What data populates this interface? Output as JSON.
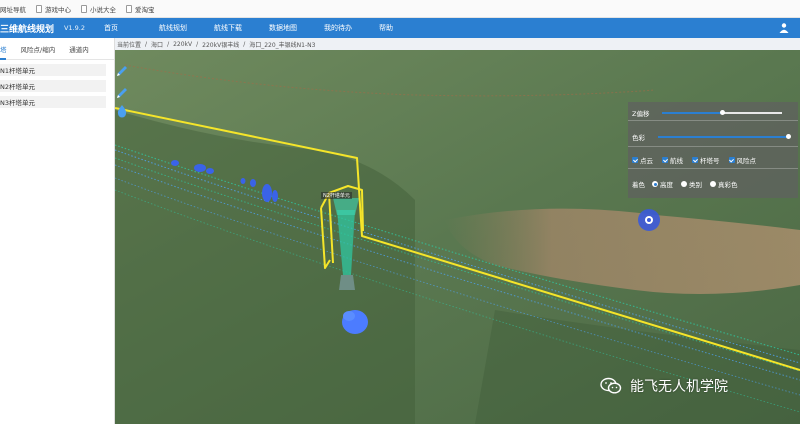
{
  "bookmarks": [
    {
      "label": "网址导航"
    },
    {
      "label": "游戏中心"
    },
    {
      "label": "小说大全"
    },
    {
      "label": "爱淘宝"
    }
  ],
  "topnav": {
    "title": "三维航线规划",
    "version": "V1.9.2",
    "items": [
      "首页",
      "航线规划",
      "航线下载",
      "数据地图",
      "我的待办",
      "帮助"
    ]
  },
  "sidebar": {
    "tabs": [
      "塔",
      "风险点/缩内",
      "通道内"
    ],
    "rows": [
      "N1杆塔单元",
      "N2杆塔单元",
      "N3杆塔单元"
    ]
  },
  "breadcrumb": [
    "当前位置",
    "/",
    "海口",
    "/",
    "220kV",
    "/",
    "220kV银丰线",
    "/",
    "海口_220_丰银线N1-N3"
  ],
  "tower_label": "N2杆塔单元",
  "controls": {
    "z_offset_label": "Z偏移",
    "z_offset_value": 0.5,
    "color_label": "色彩",
    "color_value": 1.0,
    "checkboxes": [
      "点云",
      "航线",
      "杆塔号",
      "风险点"
    ],
    "coloring_label": "着色",
    "coloring_options": [
      "高度",
      "类别",
      "真彩色"
    ],
    "coloring_selected": "高度"
  },
  "watermark": "能飞无人机学院",
  "colors": {
    "nav_blue": "#2b7fd1",
    "route_yellow": "#f5e52a",
    "pointcloud_blue": "#3a63e8",
    "pointcloud_green": "#2fc7a0"
  },
  "icons": {
    "toolbar": [
      "pencil-icon",
      "pencil-icon",
      "drop-icon"
    ],
    "user": "user-icon",
    "wechat": "wechat-icon"
  }
}
